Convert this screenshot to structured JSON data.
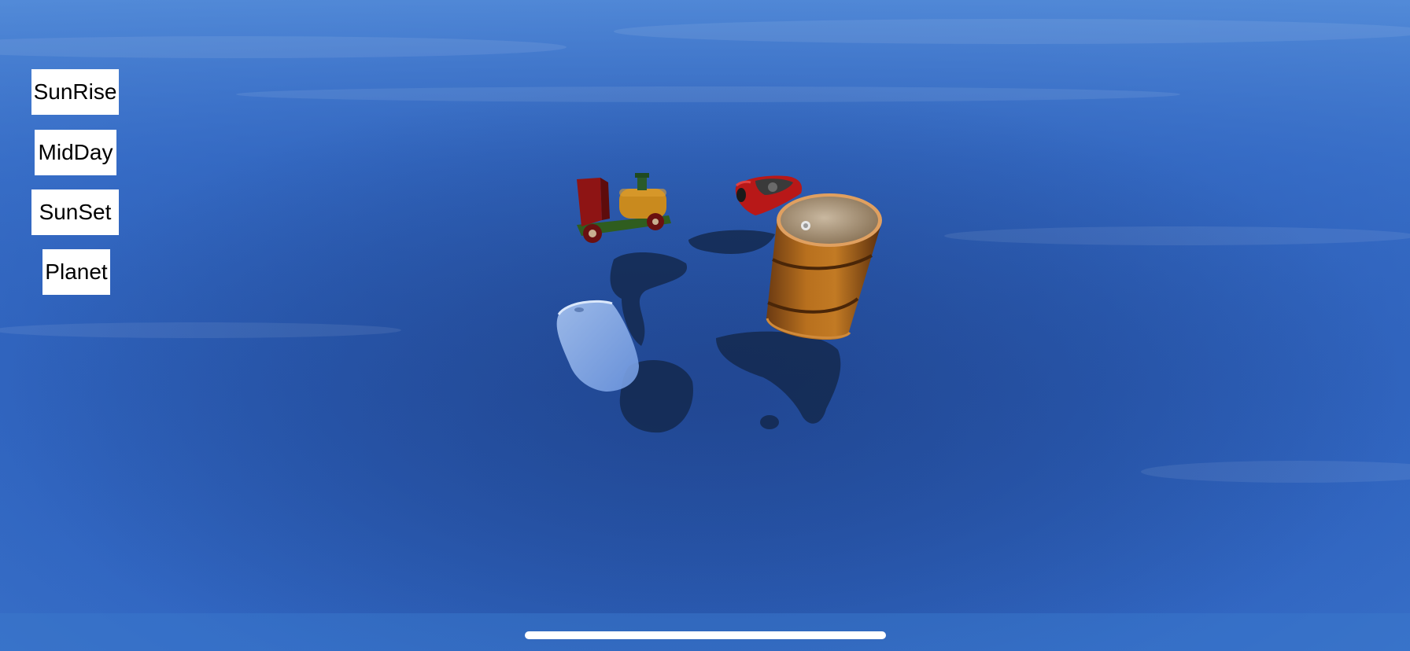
{
  "scene": {
    "background_top": "#4a86d6",
    "background_mid": "#2a58ac",
    "background_bottom": "#2d5fb8"
  },
  "controls": {
    "sunrise_label": "SunRise",
    "midday_label": "MidDay",
    "sunset_label": "SunSet",
    "planet_label": "Planet"
  },
  "objects": {
    "train": "toy-train",
    "car": "red-car",
    "barrel": "oil-barrel",
    "glass": "glass-plate"
  }
}
